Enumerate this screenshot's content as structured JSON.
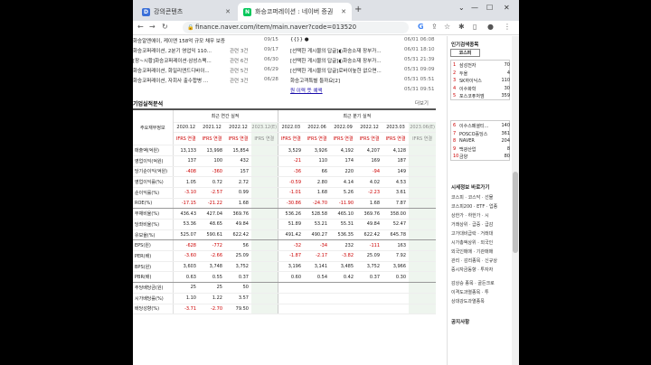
{
  "browser": {
    "tabs": [
      {
        "label": "강의콘텐츠",
        "icon": "D"
      },
      {
        "label": "화승코퍼레이션 : 네이버 증권",
        "icon": "N"
      }
    ],
    "new_tab": "+",
    "url": "finance.naver.com/item/main.naver?code=013520"
  },
  "news": [
    {
      "title": "화승알엔에이, 케이앤 158억 규모 채무 보증",
      "source": "",
      "date": "09/15"
    },
    {
      "title": "화승코퍼레이션, 2분기 영업익 110...",
      "source": "관련 3건",
      "date": "09/17"
    },
    {
      "title": "[장~시황]화승코퍼레이션·삼성스팩...",
      "source": "관련 6건",
      "date": "06/30"
    },
    {
      "title": "화승코퍼레이션, 화일리앤드디바이...",
      "source": "관련 5건",
      "date": "06/29"
    },
    {
      "title": "화승코퍼레이션, 자회사 출수합병 ...",
      "source": "관련 3건",
      "date": "06/28"
    }
  ],
  "disclosures": [
    {
      "title": "{{}} ●",
      "date": "06/01 06:08"
    },
    {
      "title": "[선택한 게시물의 답글]◐화승소재 장부가...",
      "date": "06/01 18:10"
    },
    {
      "title": "[선택한 게시물의 답글]◐화승소재 장부가...",
      "date": "05/31 21:39"
    },
    {
      "title": "[선택한 게시물의 답글]로바이높한 없으면...",
      "date": "05/31 09:09"
    },
    {
      "title": "화승고객특별 들까요[2]",
      "date": "05/31 05:51"
    },
    {
      "title": "원 이력 뜻 예액",
      "date": "05/31 09:51"
    }
  ],
  "financials": {
    "section_title": "기업실적분석",
    "more": "더보기",
    "label_header": "주요재무정보",
    "group_annual": "최근 연간 실적",
    "group_quarterly": "최근 분기 실적",
    "periods": [
      "2020.12",
      "2021.12",
      "2022.12",
      "2023.12(E)",
      "2022.03",
      "2022.06",
      "2022.09",
      "2022.12",
      "2023.03",
      "2023.06(E)"
    ],
    "ifrs": "IFRS 연결",
    "rows": [
      {
        "label": "매출액(억원)",
        "values": [
          "13,133",
          "13,998",
          "15,854",
          "",
          "3,529",
          "3,926",
          "4,192",
          "4,207",
          "4,128",
          ""
        ]
      },
      {
        "label": "영업이익(억원)",
        "values": [
          "137",
          "100",
          "432",
          "",
          "-21",
          "110",
          "174",
          "169",
          "187",
          ""
        ]
      },
      {
        "label": "당기순이익(억원)",
        "values": [
          "-408",
          "-360",
          "157",
          "",
          "-36",
          "66",
          "220",
          "-94",
          "149",
          ""
        ]
      },
      {
        "label": "영업이익률(%)",
        "values": [
          "1.05",
          "0.72",
          "2.72",
          "",
          "-0.59",
          "2.80",
          "4.14",
          "4.02",
          "4.53",
          ""
        ]
      },
      {
        "label": "순이익률(%)",
        "values": [
          "-3.10",
          "-2.57",
          "0.99",
          "",
          "-1.01",
          "1.68",
          "5.26",
          "-2.23",
          "3.61",
          ""
        ]
      },
      {
        "label": "ROE(%)",
        "values": [
          "-17.15",
          "-21.22",
          "1.68",
          "",
          "-30.86",
          "-24.70",
          "-11.90",
          "1.68",
          "7.87",
          ""
        ]
      },
      {
        "label": "부채비율(%)",
        "values": [
          "436.43",
          "427.04",
          "369.76",
          "",
          "536.26",
          "528.58",
          "465.10",
          "369.76",
          "358.00",
          ""
        ]
      },
      {
        "label": "당좌비율(%)",
        "values": [
          "53.36",
          "48.65",
          "49.84",
          "",
          "51.89",
          "53.21",
          "55.31",
          "49.84",
          "52.47",
          ""
        ]
      },
      {
        "label": "유보율(%)",
        "values": [
          "525.07",
          "590.61",
          "622.42",
          "",
          "491.42",
          "490.27",
          "536.35",
          "622.42",
          "645.78",
          ""
        ]
      },
      {
        "label": "EPS(원)",
        "values": [
          "-628",
          "-772",
          "56",
          "",
          "-32",
          "-34",
          "232",
          "-111",
          "163",
          ""
        ]
      },
      {
        "label": "PER(배)",
        "values": [
          "-3.60",
          "-2.66",
          "25.09",
          "",
          "-1.87",
          "-2.17",
          "-3.82",
          "25.09",
          "7.92",
          ""
        ]
      },
      {
        "label": "BPS(원)",
        "values": [
          "3,603",
          "3,748",
          "3,752",
          "",
          "3,196",
          "3,141",
          "3,485",
          "3,752",
          "3,966",
          ""
        ]
      },
      {
        "label": "PBR(배)",
        "values": [
          "0.63",
          "0.55",
          "0.37",
          "",
          "0.60",
          "0.54",
          "0.42",
          "0.37",
          "0.30",
          ""
        ]
      },
      {
        "label": "주당배당금(원)",
        "values": [
          "25",
          "25",
          "50",
          "",
          "",
          "",
          "",
          "",
          "",
          ""
        ]
      },
      {
        "label": "시가배당률(%)",
        "values": [
          "1.10",
          "1.22",
          "3.57",
          "",
          "",
          "",
          "",
          "",
          "",
          ""
        ]
      },
      {
        "label": "배당성향(%)",
        "values": [
          "-3.71",
          "-2.70",
          "79.50",
          "",
          "",
          "",
          "",
          "",
          "",
          ""
        ]
      }
    ]
  },
  "sidebar": {
    "popular_title": "인기검색종목",
    "kospi_tab": "코스피",
    "popular": [
      {
        "rank": "1",
        "name": "삼성전자",
        "value": "70"
      },
      {
        "rank": "2",
        "name": "두올",
        "value": "4"
      },
      {
        "rank": "3",
        "name": "SK하이닉스",
        "value": "110"
      },
      {
        "rank": "4",
        "name": "이수화학",
        "value": "30"
      },
      {
        "rank": "5",
        "name": "포스코퓨처엠",
        "value": "359"
      }
    ],
    "popular2": [
      {
        "rank": "6",
        "name": "이수스페셜티...",
        "value": "140"
      },
      {
        "rank": "7",
        "name": "POSCO홀딩스",
        "value": "361"
      },
      {
        "rank": "8",
        "name": "NAVER",
        "value": "204"
      },
      {
        "rank": "9",
        "name": "백광산업",
        "value": "8"
      },
      {
        "rank": "10",
        "name": "금양",
        "value": "80"
      }
    ],
    "market_title": "시세정보 바로가기",
    "market_lines": [
      "코스피 · 코스닥 · 선물",
      "코스피200 · ETF · 업종",
      "상한가 · 하한가 · 시",
      "거래상위 · 급증 · 급감",
      "고가대비급락 · 거래대",
      "시가총액상위 · 외국인",
      "외국인매매 · 기관매매",
      "관리 · 감리종목 · 신규상",
      "증시자금동향 · 투자자"
    ],
    "market_lines2": [
      "감상승 종목 · 골든크로",
      "이격도과열종목 · 투",
      "상대강도과열종목"
    ],
    "notice_title": "공지사항"
  }
}
